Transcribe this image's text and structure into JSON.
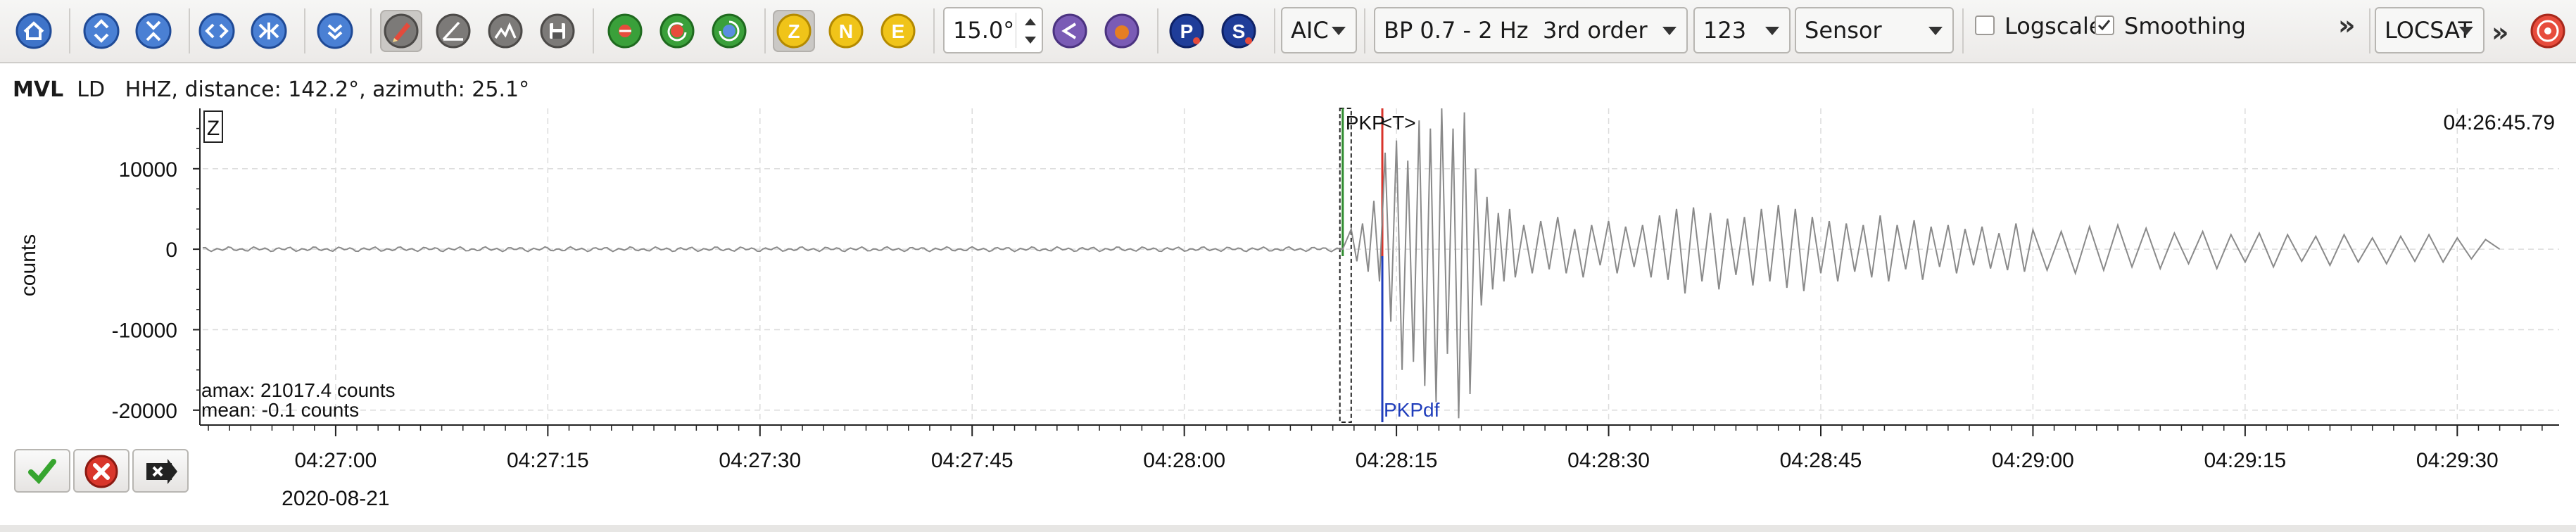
{
  "toolbar": {
    "zoom_value": "15.0°",
    "component_z": "Z",
    "component_n": "N",
    "component_e": "E",
    "phase_p": "P",
    "phase_s": "S",
    "picker_method": "AIC",
    "filter": "BP 0.7 - 2 Hz  3rd order",
    "components_select": "123",
    "unit_select": "Sensor",
    "logscale_label": "Logscale",
    "logscale_checked": false,
    "smoothing_label": "Smoothing",
    "smoothing_checked": true,
    "overflow_chevron": "»",
    "locator": "LOCSAT",
    "locator_chevron": "»",
    "colors": {
      "blue_icon": "#2b5fb8",
      "green_icon": "#3aa03a",
      "red_icon": "#c0392b",
      "yellow_comp": "#e7b416",
      "purple_icon": "#7a5bb5",
      "navy_phase": "#1f3d99"
    }
  },
  "trace": {
    "station": "MVL",
    "network": "LD",
    "channel": "HHZ",
    "info": "distance: 142.2°, azimuth: 25.1°",
    "component_label": "Z",
    "time_label": "04:26:45.79",
    "y_axis_label": "counts",
    "amax": "amax: 21017.4 counts",
    "mean": "mean: -0.1 counts",
    "date": "2020-08-21"
  },
  "chart_data": {
    "type": "line",
    "title": "",
    "xlabel": "",
    "ylabel": "counts",
    "x_ticks": [
      "04:27:00",
      "04:27:15",
      "04:27:30",
      "04:27:45",
      "04:28:00",
      "04:28:15",
      "04:28:30",
      "04:28:45",
      "04:29:00",
      "04:29:15",
      "04:29:30"
    ],
    "x_tick_seconds": [
      0,
      15,
      30,
      45,
      60,
      75,
      90,
      105,
      120,
      135,
      150
    ],
    "xlim_seconds": [
      -9.4,
      157.2
    ],
    "y_ticks": [
      10000,
      0,
      -10000,
      -20000
    ],
    "ylim": [
      -21500,
      17500
    ],
    "grid": true,
    "picks": [
      {
        "label": "PKP",
        "time_s": 71.2,
        "color": "#2e8b2e",
        "position": "top"
      },
      {
        "label": "<T>",
        "time_s": 74.0,
        "color": "#d9342b",
        "position": "top"
      },
      {
        "label": "PKPdf",
        "time_s": 74.0,
        "color": "#1f3dbb",
        "position": "bottom"
      }
    ],
    "pick_window_s": [
      71.0,
      71.8
    ],
    "series": [
      {
        "values_s": [
          -9.4,
          71.2,
          71.8,
          72.2,
          72.6,
          73.0,
          73.4,
          73.8,
          74.2,
          74.6,
          75.0,
          75.4,
          75.8,
          76.2,
          76.6,
          77.0,
          77.4,
          77.8,
          78.2,
          78.6,
          79.0,
          79.4,
          79.8,
          80.2,
          80.6,
          81.0,
          81.4,
          81.8,
          82.2,
          82.6,
          83.0,
          83.4,
          84.0,
          84.6,
          85.2,
          85.8,
          86.4,
          87.0,
          87.6,
          88.2,
          88.8,
          89.4,
          90.0,
          90.6,
          91.2,
          91.8,
          92.4,
          93.0,
          93.6,
          94.2,
          94.8,
          95.4,
          96.0,
          96.6,
          97.2,
          97.8,
          98.4,
          99.0,
          99.6,
          100.2,
          100.8,
          101.4,
          102.0,
          102.6,
          103.2,
          103.8,
          104.4,
          105.0,
          105.6,
          106.2,
          106.8,
          107.4,
          108.0,
          108.6,
          109.2,
          109.8,
          110.4,
          111.0,
          111.6,
          112.2,
          112.8,
          113.4,
          114.0,
          114.6,
          115.2,
          115.8,
          116.4,
          117.0,
          117.6,
          118.2,
          118.8,
          119.4,
          120.0,
          121.0,
          122.0,
          123.0,
          124.0,
          125.0,
          126.0,
          127.0,
          128.0,
          129.0,
          130.0,
          131.0,
          132.0,
          133.0,
          134.0,
          135.0,
          136.0,
          137.0,
          138.0,
          139.0,
          140.0,
          141.0,
          142.0,
          143.0,
          144.0,
          145.0,
          146.0,
          147.0,
          148.0,
          149.0,
          150.0,
          151.0,
          152.0,
          153.0,
          154.0,
          155.0,
          156.0,
          157.2
        ],
        "values_counts": [
          0,
          0,
          2500,
          -1500,
          3200,
          -2800,
          6000,
          -4000,
          12000,
          -9000,
          13500,
          -15000,
          11000,
          -14000,
          16000,
          -17000,
          15000,
          -19000,
          17500,
          -13000,
          15000,
          -21000,
          17000,
          -18000,
          10000,
          -7000,
          6500,
          -5000,
          4500,
          -4000,
          5000,
          -3500,
          3000,
          -3000,
          3500,
          -2500,
          4000,
          -3000,
          2500,
          -3500,
          3000,
          -2000,
          3500,
          -3000,
          2800,
          -2200,
          3000,
          -3500,
          4200,
          -3800,
          5000,
          -5500,
          5200,
          -4000,
          4500,
          -5000,
          3800,
          -3200,
          4000,
          -4500,
          5000,
          -4000,
          5500,
          -4800,
          5000,
          -5200,
          4000,
          -3000,
          3500,
          -4000,
          3200,
          -2800,
          3000,
          -3500,
          4200,
          -4000,
          3000,
          -2500,
          3600,
          -3800,
          2800,
          -2200,
          3000,
          -3000,
          2500,
          -2000,
          2800,
          -2400,
          2000,
          -2600,
          3200,
          -2800,
          2400,
          -2600,
          2200,
          -3000,
          2800,
          -2600,
          3000,
          -2200,
          2600,
          -2400,
          2000,
          -1800,
          2200,
          -2400,
          1800,
          -1600,
          2000,
          -2200,
          1800,
          -1500,
          1600,
          -2000,
          1800,
          -1600,
          1400,
          -1800,
          1600,
          -1500,
          1800,
          -1600,
          1400,
          -1200,
          1200,
          0
        ]
      }
    ]
  },
  "actions": {
    "accept_label": "accept",
    "reject_label": "reject",
    "apply_label": "apply"
  }
}
